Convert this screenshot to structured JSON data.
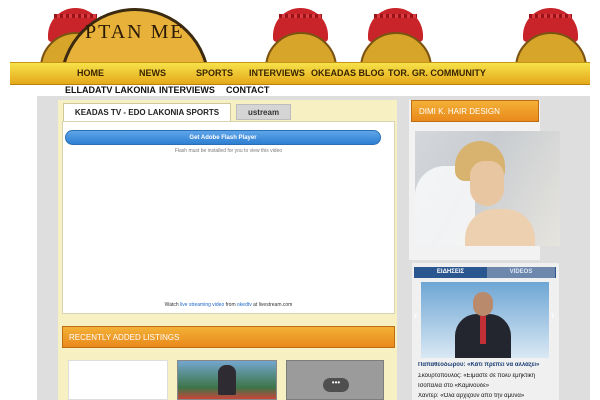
{
  "header": {
    "brand_text": "ΡΤΑΝ ΜΕ"
  },
  "nav": {
    "items": [
      "HOME",
      "NEWS",
      "SPORTS",
      "INTERVIEWS",
      "OKEADAS BLOG",
      "TOR. GR. COMMUNITY"
    ]
  },
  "subnav": {
    "items": [
      "ELLADATV LAKONIA",
      "INTERVIEWS",
      "CONTACT"
    ]
  },
  "player": {
    "tab_active": "KEADAS TV - EDO LAKONIA SPORTS",
    "tab_inactive": "ustream",
    "flash_button": "Get Adobe Flash Player",
    "flash_note": "Flash must be installed for you to view this video",
    "watch_prefix": "Watch",
    "watch_link1": "live streaming video",
    "watch_mid": "from",
    "watch_link2": "okedtv",
    "watch_suffix": "at livestream.com"
  },
  "listings": {
    "title": "RECENTLY ADDED LISTINGS"
  },
  "sidebar": {
    "ad_title": "DIMI K. HAIR DESIGN",
    "news_tabs": [
      "ΕΙΔΗΣΕΙΣ",
      "VIDEOS"
    ],
    "news_items": [
      "Παπαθεοδώρου: «Κάτι πρέπει να αλλάξει»",
      "Σκουρτόπουλος: «Είμαστε σε πολύ εμήκτικη",
      "Ισοπαλία στο «Καμινούδε»",
      "Χάντερ: «Όλα αρχίζουν από την άμυνα»"
    ]
  }
}
